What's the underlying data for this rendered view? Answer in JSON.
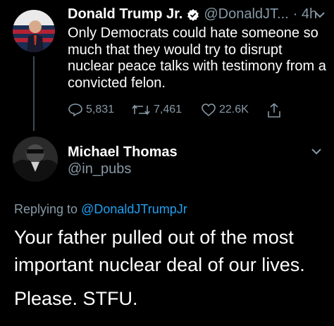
{
  "tweet1": {
    "name": "Donald Trump Jr.",
    "handle": "@DonaldJT...",
    "time": "· 4h",
    "text": "Only Democrats could hate someone so much that they would try to disrupt nuclear peace talks with testimony from a convicted felon.",
    "replies": "5,831",
    "retweets": "7,461",
    "likes": "22.6K"
  },
  "tweet2": {
    "name": "Michael Thomas",
    "handle": "@in_pubs",
    "replying_prefix": "Replying to ",
    "replying_to": "@DonaldJTrumpJr",
    "text": "Your father pulled out of the most important nuclear deal of our lives.",
    "text2": "Please. STFU."
  },
  "colors": {
    "background": "#000000",
    "muted": "#8899a6",
    "link": "#1da1f2"
  },
  "icons": [
    "verified-badge-icon",
    "chevron-down-icon",
    "reply-icon",
    "retweet-icon",
    "like-icon",
    "share-icon"
  ]
}
